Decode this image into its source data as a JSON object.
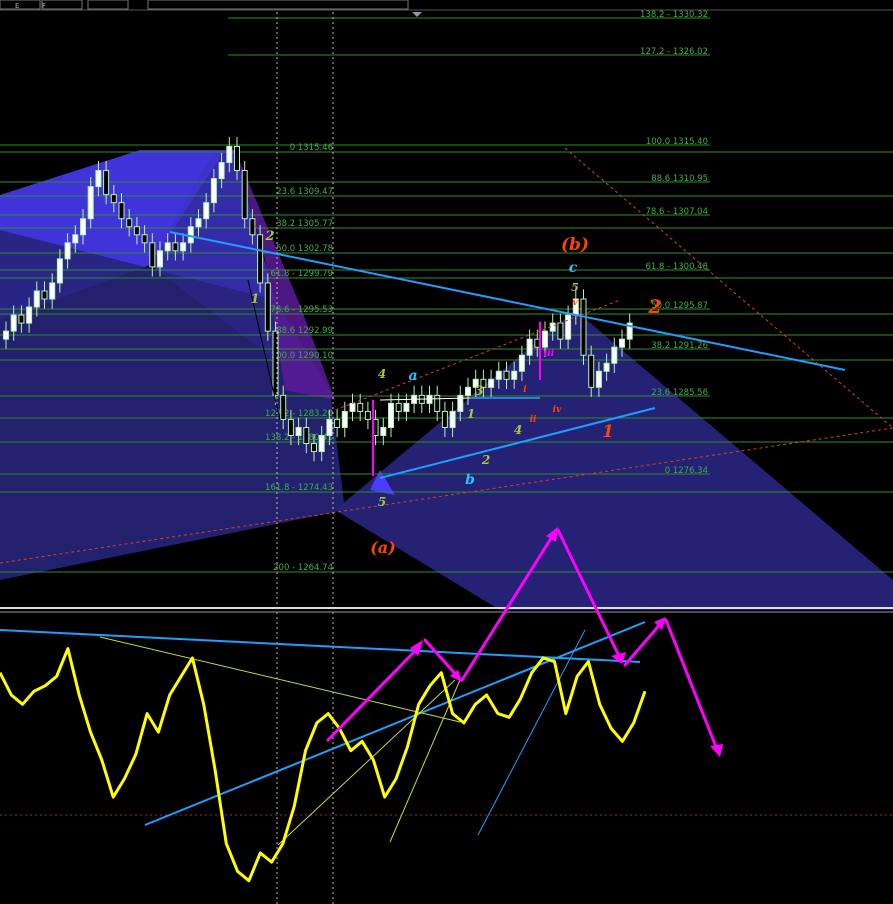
{
  "colors": {
    "background": "#000000",
    "fib_line": "#2e8b2e",
    "fib_text": "#3cb043",
    "bull_candle": "#ffffff",
    "bear_candle": "#000000",
    "candle_wick": "#b8f0b8",
    "trendline": "#1e9fff",
    "oscillator": "#ffff00",
    "projection": "#ff00ff",
    "harmonic_fill": "#4b3cff",
    "harmonic_dark": "#27237a",
    "pattern_purple": "#5a1a9a",
    "wave_orange": "#ff4500",
    "wave_cyan": "#1ec8ff",
    "wave_green": "#a8c83c",
    "dashed_red": "#d84020"
  },
  "toolbar": {
    "left_glyph": "E",
    "right_glyph": "F"
  },
  "fib_levels_right": [
    {
      "label": "138.2 - 1330.32"
    },
    {
      "label": "127.2 - 1326.02"
    },
    {
      "label": "100.0 1315.40"
    },
    {
      "label": "88.6 1310.95"
    },
    {
      "label": "78.6 - 1307.04"
    },
    {
      "label": "61.8 - 1300.48"
    },
    {
      "label": "50.0 1295.87"
    },
    {
      "label": "38.2 1291.26"
    },
    {
      "label": "23.6 1285.56"
    },
    {
      "label": "0 1276.34"
    }
  ],
  "fib_levels_left": [
    {
      "label": "0 1315.46"
    },
    {
      "label": "23.6 1309.47"
    },
    {
      "label": "38.2 1305.77"
    },
    {
      "label": "50.0 1302.78"
    },
    {
      "label": "61.8 - 1299.79"
    },
    {
      "label": "78.6 - 1295.53"
    },
    {
      "label": "88.6 1292.99"
    },
    {
      "label": "100.0 1290.10"
    },
    {
      "label": "127.2 - 1283.20"
    },
    {
      "label": "138.2 - 1280.41"
    },
    {
      "label": "161.8 - 1274.43"
    },
    {
      "label": "200 - 1264.74"
    }
  ],
  "wave_labels": [
    {
      "text": "(b)",
      "color": "#ff4500"
    },
    {
      "text": "c",
      "color": "#1ec8ff"
    },
    {
      "text": "5",
      "color": "#a8c83c"
    },
    {
      "text": "v",
      "color": "#ff4500"
    },
    {
      "text": "2",
      "color": "#ff4500"
    },
    {
      "text": "iii",
      "color": "#ff00ff"
    },
    {
      "text": "i",
      "color": "#ff4500"
    },
    {
      "text": "ii",
      "color": "#ff4500"
    },
    {
      "text": "iv",
      "color": "#ff4500"
    },
    {
      "text": "1",
      "color": "#ff4500"
    },
    {
      "text": "4",
      "color": "#a8c83c"
    },
    {
      "text": "a",
      "color": "#1ec8ff"
    },
    {
      "text": "3",
      "color": "#a8c83c"
    },
    {
      "text": "1",
      "color": "#a8c83c"
    },
    {
      "text": "4",
      "color": "#a8c83c"
    },
    {
      "text": "2",
      "color": "#a8c83c"
    },
    {
      "text": "b",
      "color": "#1ec8ff"
    },
    {
      "text": "5",
      "color": "#a8c83c"
    },
    {
      "text": "(a)",
      "color": "#ff4500"
    },
    {
      "text": "2",
      "color": "#a8c83c"
    },
    {
      "text": "1",
      "color": "#a8c83c"
    }
  ],
  "chart_data": {
    "type": "candlestick",
    "title": "",
    "y_range": [
      1262,
      1331
    ],
    "candles_close": [
      1292,
      1294,
      1293,
      1295,
      1297,
      1296,
      1298,
      1301,
      1303,
      1304,
      1306,
      1310,
      1312,
      1309,
      1308,
      1306,
      1305,
      1304,
      1303,
      1300,
      1302,
      1303,
      1302,
      1303,
      1305,
      1306,
      1308,
      1311,
      1313,
      1315,
      1312,
      1306,
      1304,
      1298,
      1292,
      1284,
      1281,
      1279,
      1280,
      1278,
      1277,
      1279,
      1281,
      1280,
      1282,
      1283,
      1282,
      1281,
      1279,
      1280,
      1283,
      1282,
      1283,
      1284,
      1283,
      1284,
      1282,
      1280,
      1282,
      1284,
      1285,
      1286,
      1285,
      1286,
      1287,
      1286,
      1287,
      1289,
      1291,
      1290,
      1292,
      1293,
      1291,
      1294,
      1296,
      1289,
      1285,
      1287,
      1288,
      1290,
      1291,
      1293
    ],
    "oscillator": [
      0.72,
      0.6,
      0.55,
      0.62,
      0.65,
      0.7,
      0.85,
      0.6,
      0.4,
      0.25,
      0.05,
      0.15,
      0.28,
      0.5,
      0.4,
      0.6,
      0.7,
      0.8,
      0.55,
      0.2,
      -0.2,
      -0.35,
      -0.4,
      -0.25,
      -0.3,
      -0.2,
      0.0,
      0.3,
      0.45,
      0.5,
      0.42,
      0.3,
      0.35,
      0.25,
      0.05,
      0.15,
      0.32,
      0.55,
      0.65,
      0.72,
      0.5,
      0.45,
      0.55,
      0.6,
      0.5,
      0.48,
      0.58,
      0.72,
      0.8,
      0.78,
      0.5,
      0.7,
      0.78,
      0.55,
      0.42,
      0.35,
      0.45,
      0.62
    ],
    "oscillator_zero_line": "dashed"
  }
}
